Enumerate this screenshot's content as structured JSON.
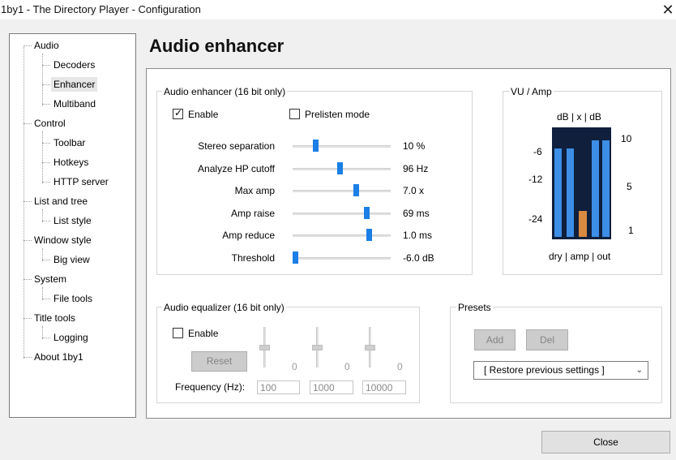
{
  "window": {
    "title": "1by1 - The Directory Player - Configuration",
    "close_glyph": "✕"
  },
  "tree": {
    "items": [
      {
        "label": "Audio",
        "level": 0
      },
      {
        "label": "Decoders",
        "level": 1
      },
      {
        "label": "Enhancer",
        "level": 1,
        "selected": true
      },
      {
        "label": "Multiband",
        "level": 1
      },
      {
        "label": "Control",
        "level": 0
      },
      {
        "label": "Toolbar",
        "level": 1
      },
      {
        "label": "Hotkeys",
        "level": 1
      },
      {
        "label": "HTTP server",
        "level": 1
      },
      {
        "label": "List and tree",
        "level": 0
      },
      {
        "label": "List style",
        "level": 1
      },
      {
        "label": "Window style",
        "level": 0
      },
      {
        "label": "Big view",
        "level": 1
      },
      {
        "label": "System",
        "level": 0
      },
      {
        "label": "File tools",
        "level": 1
      },
      {
        "label": "Title tools",
        "level": 0
      },
      {
        "label": "Logging",
        "level": 1
      },
      {
        "label": "About 1by1",
        "level": 0
      }
    ]
  },
  "page": {
    "title": "Audio enhancer"
  },
  "enhancer": {
    "group_label": "Audio enhancer (16 bit only)",
    "enable_label": "Enable",
    "enable_checked": true,
    "prelisten_label": "Prelisten mode",
    "prelisten_checked": false,
    "sliders": [
      {
        "label": "Stereo separation",
        "value": "10 %",
        "position": 0.22
      },
      {
        "label": "Analyze HP cutoff",
        "value": "96 Hz",
        "position": 0.48
      },
      {
        "label": "Max amp",
        "value": "7.0 x",
        "position": 0.66
      },
      {
        "label": "Amp raise",
        "value": "69 ms",
        "position": 0.77
      },
      {
        "label": "Amp reduce",
        "value": "1.0 ms",
        "position": 0.8
      },
      {
        "label": "Threshold",
        "value": "-6.0 dB",
        "position": 0.0
      }
    ]
  },
  "vu": {
    "group_label": "VU / Amp",
    "top_label": "dB |  x  | dB",
    "left_scale": [
      "-6",
      "-12",
      "-24"
    ],
    "right_scale": [
      "10",
      "5",
      "1"
    ],
    "bottom_label": "dry | amp | out",
    "levels": {
      "dry_l": 0.81,
      "dry_r": 0.81,
      "amp": 0.24,
      "out_l": 0.88,
      "out_r": 0.88
    },
    "colors": {
      "bar": "#3c8ee6",
      "amp": "#d98a40",
      "background": "#0f1f3c"
    }
  },
  "equalizer": {
    "group_label": "Audio equalizer (16 bit only)",
    "enable_label": "Enable",
    "enable_checked": false,
    "reset_label": "Reset",
    "bands": [
      {
        "value": "0",
        "frequency": "100"
      },
      {
        "value": "0",
        "frequency": "1000"
      },
      {
        "value": "0",
        "frequency": "10000"
      }
    ],
    "frequency_label": "Frequency (Hz):"
  },
  "presets": {
    "group_label": "Presets",
    "add_label": "Add",
    "del_label": "Del",
    "selected": "[ Restore previous settings ]"
  },
  "footer": {
    "close_label": "Close"
  },
  "colors": {
    "accent": "#1b7fe6"
  }
}
